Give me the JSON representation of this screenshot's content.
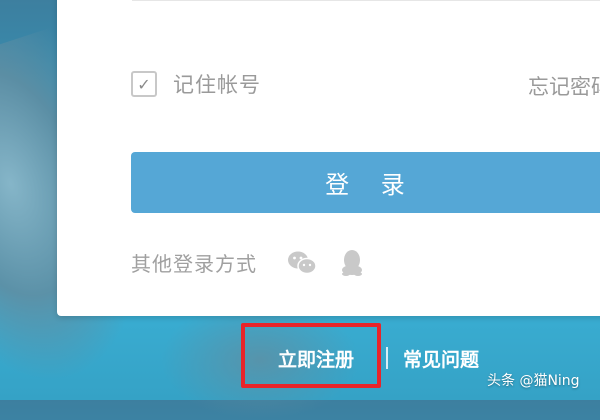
{
  "login_card": {
    "remember_label": "记住帐号",
    "remember_checked": true,
    "checkbox_glyph": "✓",
    "forgot_label": "忘记密码",
    "login_button_label": "登 录",
    "other_methods_label": "其他登录方式",
    "other_method_icons": [
      "wechat-icon",
      "qq-icon"
    ]
  },
  "bottom_links": {
    "register_label": "立即注册",
    "faq_label": "常见问题"
  },
  "watermark": {
    "text": "头条 @猫Ning"
  },
  "colors": {
    "button": "#55a7d6",
    "highlight_box": "#e8242a",
    "background": "#2f9dc2"
  }
}
